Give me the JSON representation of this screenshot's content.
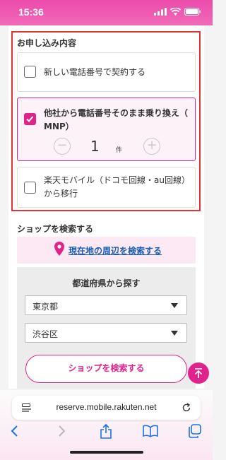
{
  "status_bar": {
    "time": "15:36"
  },
  "application": {
    "section_title": "お申し込み内容",
    "options": [
      {
        "label": "新しい電話番号で契約する",
        "checked": false
      },
      {
        "label_line1": "他社から電話番号そのまま乗り換え（",
        "label_line2": "MNP）",
        "checked": true
      },
      {
        "label_line1": "楽天モバイル（ドコモ回線・au回線）",
        "label_line2": "から移行",
        "checked": false
      }
    ],
    "stepper": {
      "value": "1",
      "unit": "件",
      "minus": "−",
      "plus": "+"
    }
  },
  "shop_search": {
    "section_title": "ショップを検索する",
    "nearby_label": "現在地の周辺を検索する",
    "prefecture_title": "都道府県から探す",
    "prefecture_value": "東京都",
    "city_value": "渋谷区",
    "search_button_label": "ショップを検索する"
  },
  "browser": {
    "url": "reserve.mobile.rakuten.net"
  },
  "colors": {
    "accent": "#e0238a",
    "highlight_frame": "#e53333",
    "link": "#1a5fb4"
  }
}
